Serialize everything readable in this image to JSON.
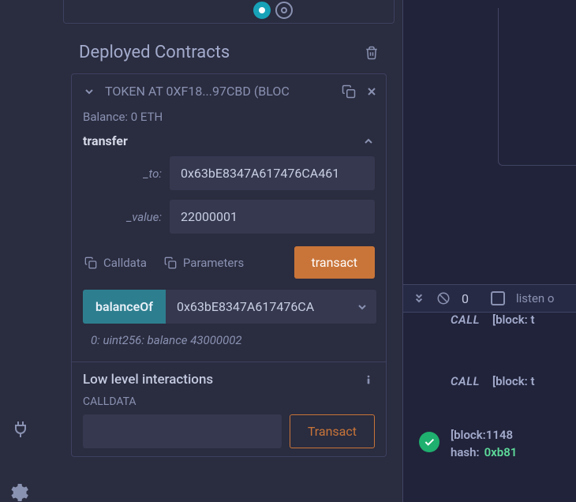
{
  "section": {
    "title": "Deployed Contracts"
  },
  "contract": {
    "title": "TOKEN AT 0XF18...97CBD (BLOC",
    "balance": "Balance: 0 ETH"
  },
  "transfer": {
    "name": "transfer",
    "to_label": "_to:",
    "to_value": "0x63bE8347A617476CA461",
    "value_label": "_value:",
    "value_value": "22000001",
    "calldata_btn": "Calldata",
    "params_btn": "Parameters",
    "transact_btn": "transact"
  },
  "balanceOf": {
    "name": "balanceOf",
    "arg": "0x63bE8347A617476CA",
    "result": "0: uint256: balance 43000002"
  },
  "lowlevel": {
    "title": "Low level interactions",
    "calldata_label": "CALLDATA",
    "transact_btn": "Transact"
  },
  "terminal": {
    "count": "0",
    "listen": "listen o",
    "lines": [
      {
        "type": "call",
        "text": "[block: t"
      },
      {
        "type": "call",
        "text": "[block: t"
      }
    ],
    "success": {
      "line1": "[block:1148",
      "hash_label": "hash:",
      "hash_value": "0xb81"
    }
  }
}
